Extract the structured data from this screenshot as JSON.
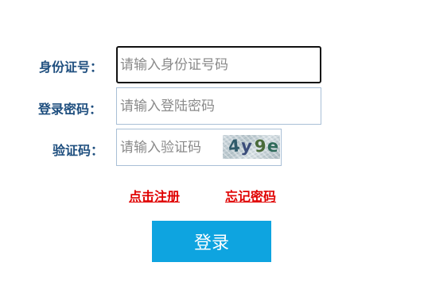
{
  "form": {
    "id_label": "身份证号：",
    "id_placeholder": "请输入身份证号码",
    "password_label": "登录密码：",
    "password_placeholder": "请输入登陆密码",
    "captcha_label": "验证码：",
    "captcha_placeholder": "请输入验证码",
    "captcha_chars": [
      "4",
      "y",
      "9",
      "e"
    ]
  },
  "links": {
    "register": "点击注册",
    "forgot_password": "忘记密码"
  },
  "login_button": "登录",
  "colors": {
    "label": "#1f4f7f",
    "link": "#e00000",
    "button": "#0ea4e0",
    "field_border": "#a9bfd6"
  }
}
